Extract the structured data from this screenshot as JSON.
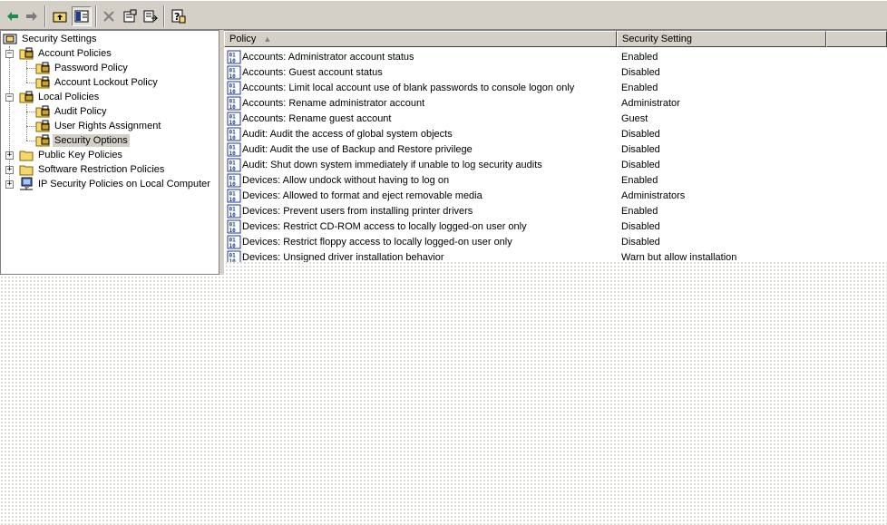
{
  "toolbar": {
    "buttons": [
      "back-icon",
      "forward-icon",
      "up-folder-icon",
      "show-hide-tree-icon",
      "delete-icon",
      "properties-icon",
      "export-list-icon",
      "help-icon"
    ]
  },
  "tree": {
    "root": "Security Settings",
    "account_policies": "Account Policies",
    "password_policy": "Password Policy",
    "account_lockout_policy": "Account Lockout Policy",
    "local_policies": "Local Policies",
    "audit_policy": "Audit Policy",
    "user_rights_assignment": "User Rights Assignment",
    "security_options": "Security Options",
    "public_key_policies": "Public Key Policies",
    "software_restriction_policies": "Software Restriction Policies",
    "ip_security_policies": "IP Security Policies on Local Computer"
  },
  "list": {
    "columns": {
      "policy": "Policy",
      "setting": "Security Setting"
    },
    "rows": [
      {
        "policy": "Accounts: Administrator account status",
        "setting": "Enabled"
      },
      {
        "policy": "Accounts: Guest account status",
        "setting": "Disabled"
      },
      {
        "policy": "Accounts: Limit local account use of blank passwords to console logon only",
        "setting": "Enabled"
      },
      {
        "policy": "Accounts: Rename administrator account",
        "setting": "Administrator"
      },
      {
        "policy": "Accounts: Rename guest account",
        "setting": "Guest"
      },
      {
        "policy": "Audit: Audit the access of global system objects",
        "setting": "Disabled"
      },
      {
        "policy": "Audit: Audit the use of Backup and Restore privilege",
        "setting": "Disabled"
      },
      {
        "policy": "Audit: Shut down system immediately if unable to log security audits",
        "setting": "Disabled"
      },
      {
        "policy": "Devices: Allow undock without having to log on",
        "setting": "Enabled"
      },
      {
        "policy": "Devices: Allowed to format and eject removable media",
        "setting": "Administrators"
      },
      {
        "policy": "Devices: Prevent users from installing printer drivers",
        "setting": "Enabled"
      },
      {
        "policy": "Devices: Restrict CD-ROM access to locally logged-on user only",
        "setting": "Disabled"
      },
      {
        "policy": "Devices: Restrict floppy access to locally logged-on user only",
        "setting": "Disabled"
      },
      {
        "policy": "Devices: Unsigned driver installation behavior",
        "setting": "Warn but allow installation"
      }
    ]
  },
  "colors": {
    "chrome": "#d4d0c8",
    "folder": "#f5d76e",
    "policy_icon": "#1f3a93"
  }
}
